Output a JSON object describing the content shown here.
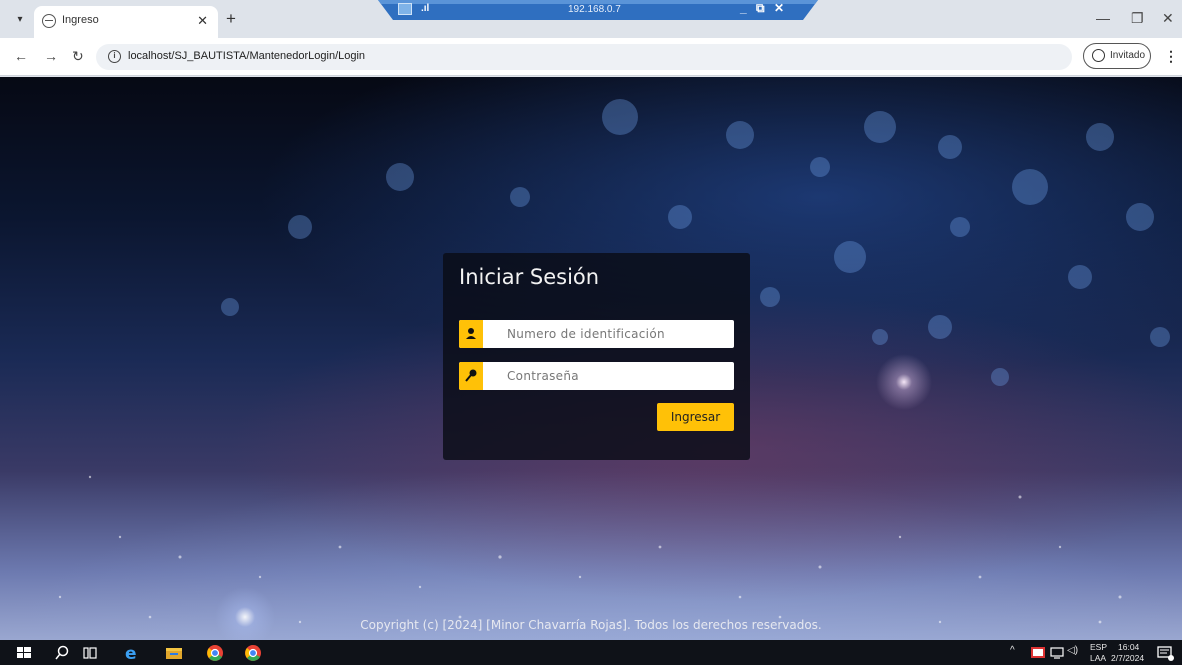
{
  "browser": {
    "tab_title": "Ingreso",
    "new_tab": "+",
    "url": "localhost/SJ_BAUTISTA/MantenedorLogin/Login",
    "profile_label": "Invitado"
  },
  "remote_session": {
    "address": "192.168.0.7"
  },
  "login": {
    "title": "Iniciar Sesión",
    "id_placeholder": "Numero de identificación",
    "password_placeholder": "Contraseña",
    "submit_label": "Ingresar"
  },
  "footer": {
    "copyright": "Copyright (c) [2024] [Minor Chavarría Rojas]. Todos los derechos reservados."
  },
  "taskbar": {
    "language": "ESP",
    "language_sub": "LAA",
    "time": "16:04",
    "date": "2/7/2024"
  },
  "icons": {
    "user_field": "user-icon",
    "password_field": "key-icon"
  },
  "colors": {
    "accent": "#ffc107",
    "card": "#0a0c16"
  }
}
